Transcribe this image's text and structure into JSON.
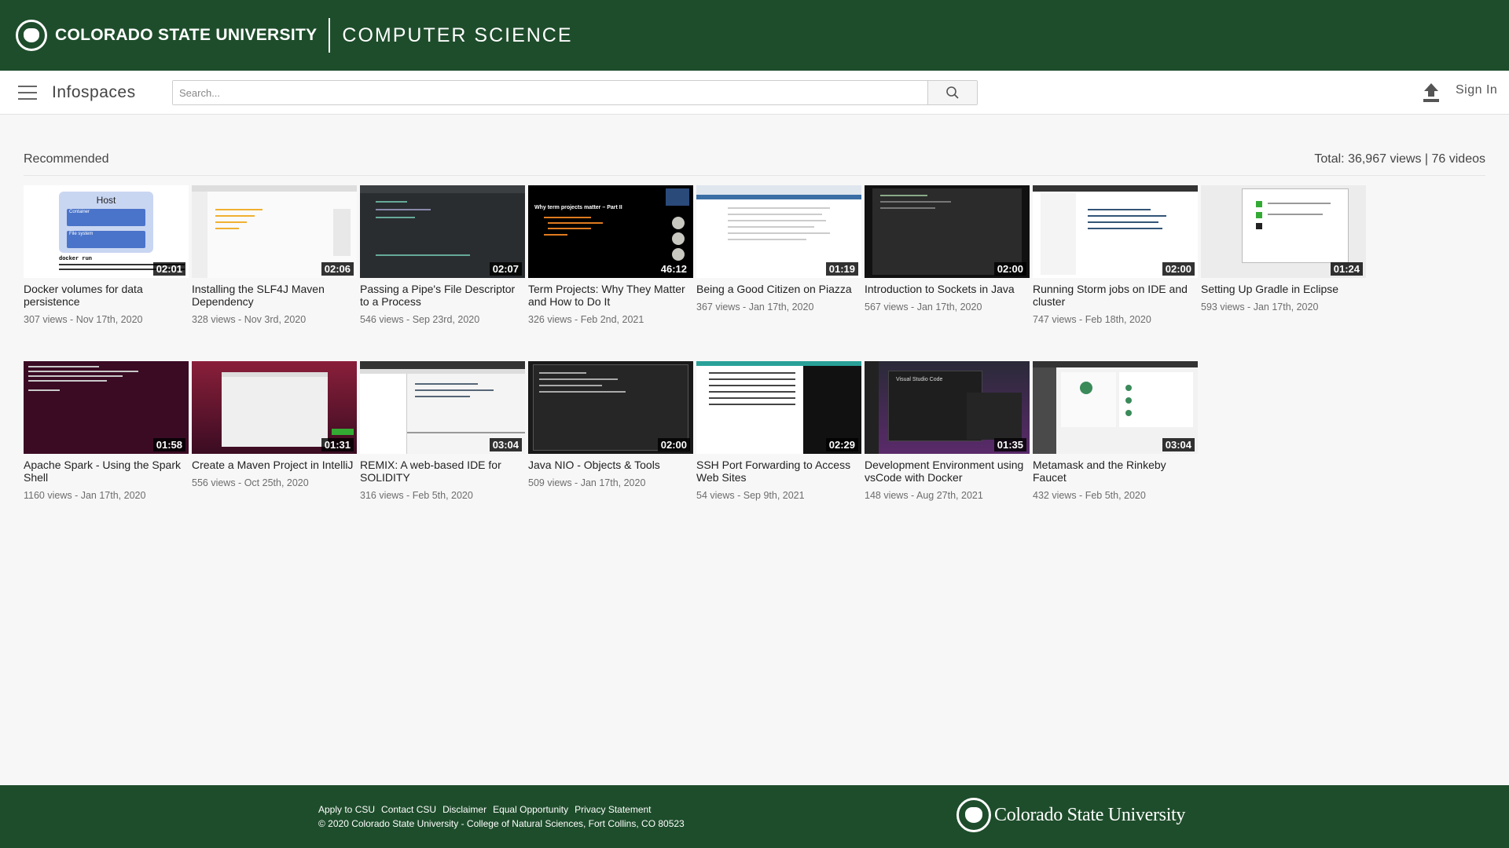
{
  "banner": {
    "university": "COLORADO STATE UNIVERSITY",
    "department": "COMPUTER SCIENCE"
  },
  "toolbar": {
    "title": "Infospaces",
    "search_placeholder": "Search...",
    "sign_in": "Sign In"
  },
  "section": {
    "title": "Recommended",
    "stats": "Total: 36,967 views | 76 videos"
  },
  "videos": [
    {
      "title": "Docker volumes for data persistence",
      "meta": "307 views - Nov 17th, 2020",
      "duration": "02:01"
    },
    {
      "title": "Installing the SLF4J Maven Dependency",
      "meta": "328 views - Nov 3rd, 2020",
      "duration": "02:06"
    },
    {
      "title": "Passing a Pipe's File Descriptor to a Process",
      "meta": "546 views - Sep 23rd, 2020",
      "duration": "02:07"
    },
    {
      "title": "Term Projects: Why They Matter and How to Do It",
      "meta": "326 views - Feb 2nd, 2021",
      "duration": "46:12"
    },
    {
      "title": "Being a Good Citizen on Piazza",
      "meta": "367 views - Jan 17th, 2020",
      "duration": "01:19"
    },
    {
      "title": "Introduction to Sockets in Java",
      "meta": "567 views - Jan 17th, 2020",
      "duration": "02:00"
    },
    {
      "title": "Running Storm jobs on IDE and cluster",
      "meta": "747 views - Feb 18th, 2020",
      "duration": "02:00"
    },
    {
      "title": "Setting Up Gradle in Eclipse",
      "meta": "593 views - Jan 17th, 2020",
      "duration": "01:24"
    },
    {
      "title": "Apache Spark - Using the Spark Shell",
      "meta": "1160 views - Jan 17th, 2020",
      "duration": "01:58"
    },
    {
      "title": "Create a Maven Project in IntelliJ",
      "meta": "556 views - Oct 25th, 2020",
      "duration": "01:31"
    },
    {
      "title": "REMIX: A web-based IDE for SOLIDITY",
      "meta": "316 views - Feb 5th, 2020",
      "duration": "03:04"
    },
    {
      "title": "Java NIO - Objects & Tools",
      "meta": "509 views - Jan 17th, 2020",
      "duration": "02:00"
    },
    {
      "title": "SSH Port Forwarding to Access Web Sites",
      "meta": "54 views - Sep 9th, 2021",
      "duration": "02:29"
    },
    {
      "title": "Development Environment using vsCode with Docker",
      "meta": "148 views - Aug 27th, 2021",
      "duration": "01:35"
    },
    {
      "title": "Metamask and the Rinkeby Faucet",
      "meta": "432 views - Feb 5th, 2020",
      "duration": "03:04"
    }
  ],
  "thumb_text": {
    "host": "Host",
    "container": "Container",
    "file_system": "File system",
    "docker_cmd": "docker run",
    "slide_title": "Why term projects matter – Part II",
    "vscode": "Visual Studio Code"
  },
  "footer": {
    "links": [
      "Apply to CSU",
      "Contact CSU",
      "Disclaimer",
      "Equal Opportunity",
      "Privacy Statement"
    ],
    "copyright": "© 2020 Colorado State University - College of Natural Sciences, Fort Collins, CO 80523",
    "logo_text": "Colorado State University"
  },
  "colors": {
    "brand_green": "#1e4d2b"
  },
  "icons": {
    "menu": "hamburger-menu-icon",
    "search": "magnifier-icon",
    "upload": "upload-icon",
    "logo": "ram-logo-icon"
  }
}
